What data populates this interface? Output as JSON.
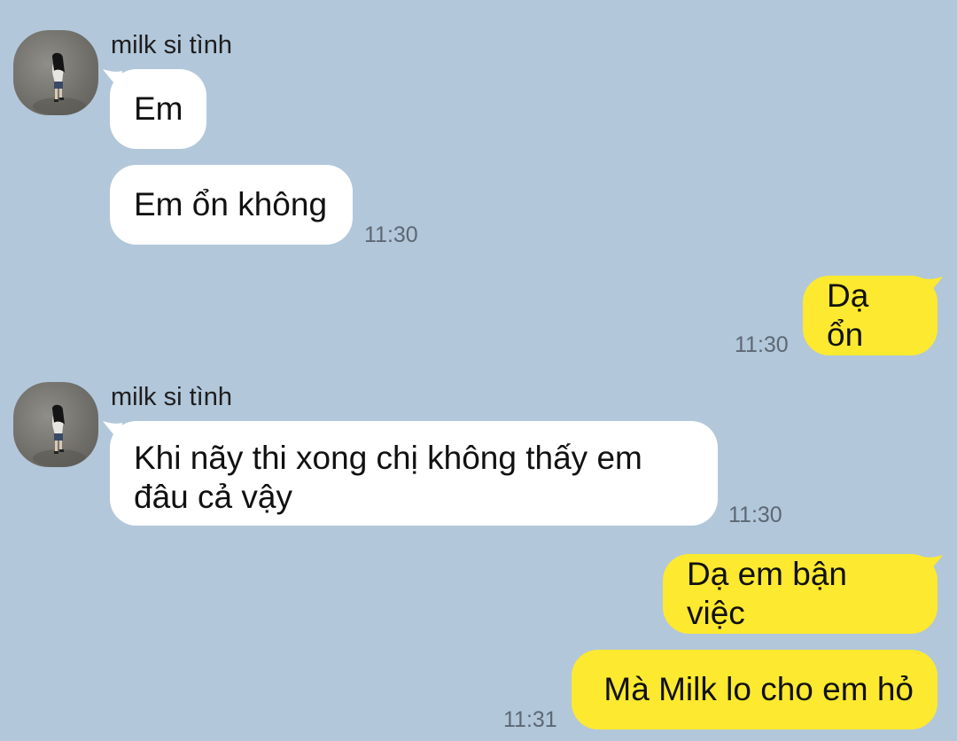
{
  "conversation": {
    "contact_name": "milk si tình",
    "messages": [
      {
        "sender": "milk si tình",
        "direction": "incoming",
        "text": "Em",
        "time": ""
      },
      {
        "sender": "milk si tình",
        "direction": "incoming",
        "text": "Em ổn không",
        "time": "11:30"
      },
      {
        "sender": "me",
        "direction": "outgoing",
        "text": "Dạ ổn",
        "time": "11:30"
      },
      {
        "sender": "milk si tình",
        "direction": "incoming",
        "text": "Khi nãy thi xong chị không thấy em",
        "text_line2": "đâu cả vậy",
        "time": "11:30"
      },
      {
        "sender": "me",
        "direction": "outgoing",
        "text": "Dạ em bận việc",
        "time": ""
      },
      {
        "sender": "me",
        "direction": "outgoing",
        "text": "Mà Milk lo cho em hỏ",
        "time": "11:31"
      }
    ]
  },
  "icons": {
    "avatar": "profile-photo-person-walking"
  },
  "colors": {
    "background": "#b2c7da",
    "incoming_bubble": "#ffffff",
    "outgoing_bubble": "#fde92f",
    "timestamp": "#5d6874"
  }
}
